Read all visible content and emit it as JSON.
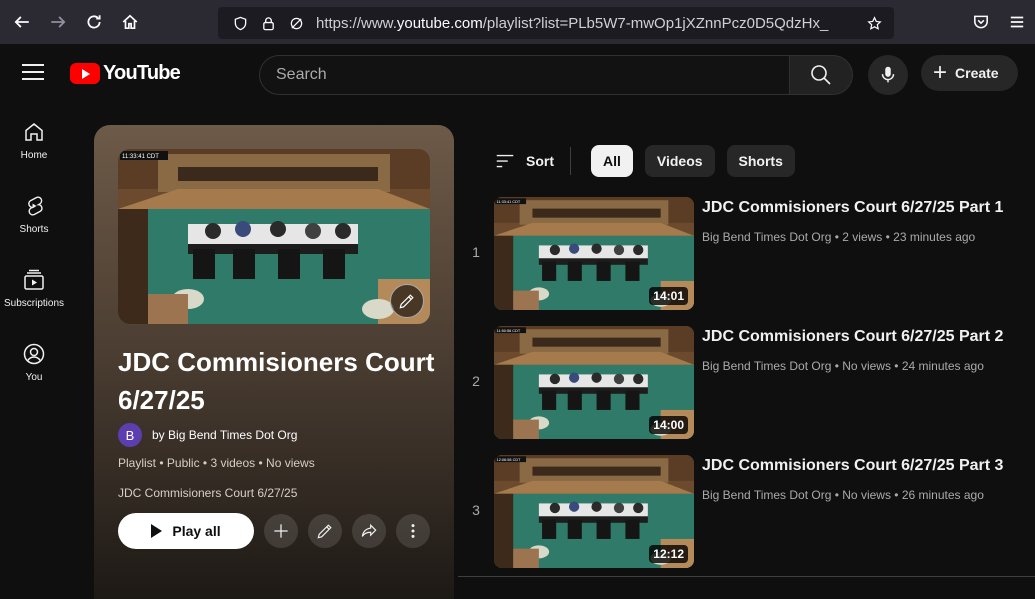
{
  "browser": {
    "url_prefix": "https://www.",
    "url_host": "youtube.com",
    "url_path": "/playlist?list=PLb5W7-mwOp1jXZnnPcz0D5QdzHx_"
  },
  "masthead": {
    "logo_text": "YouTube",
    "search_placeholder": "Search",
    "create_label": "Create"
  },
  "guide": {
    "items": [
      {
        "label": "Home"
      },
      {
        "label": "Shorts"
      },
      {
        "label": "Subscriptions"
      },
      {
        "label": "You"
      }
    ]
  },
  "playlist": {
    "thumb_timestamp": "11:33:41 CDT",
    "title": "JDC Commisioners Court 6/27/25",
    "owner_initial": "B",
    "owner_prefix": "by",
    "owner_name": "Big Bend Times Dot Org",
    "meta_type": "Playlist",
    "meta_privacy": "Public",
    "meta_count": "3 videos",
    "meta_views": "No views",
    "description": "JDC Commisioners Court 6/27/25",
    "play_all_label": "Play all"
  },
  "filters": {
    "sort_label": "Sort",
    "chips": [
      "All",
      "Videos",
      "Shorts"
    ],
    "active": "All"
  },
  "videos": [
    {
      "index": "1",
      "title": "JDC Commisioners Court 6/27/25 Part 1",
      "channel": "Big Bend Times Dot Org",
      "views": "2 views",
      "age": "23 minutes ago",
      "duration": "14:01",
      "stamp": "11:33:41 CDT"
    },
    {
      "index": "2",
      "title": "JDC Commisioners Court 6/27/25 Part 2",
      "channel": "Big Bend Times Dot Org",
      "views": "No views",
      "age": "24 minutes ago",
      "duration": "14:00",
      "stamp": "11:50:56 CDT"
    },
    {
      "index": "3",
      "title": "JDC Commisioners Court 6/27/25 Part 3",
      "channel": "Big Bend Times Dot Org",
      "views": "No views",
      "age": "26 minutes ago",
      "duration": "12:12",
      "stamp": "12:06:58 CDT"
    }
  ]
}
